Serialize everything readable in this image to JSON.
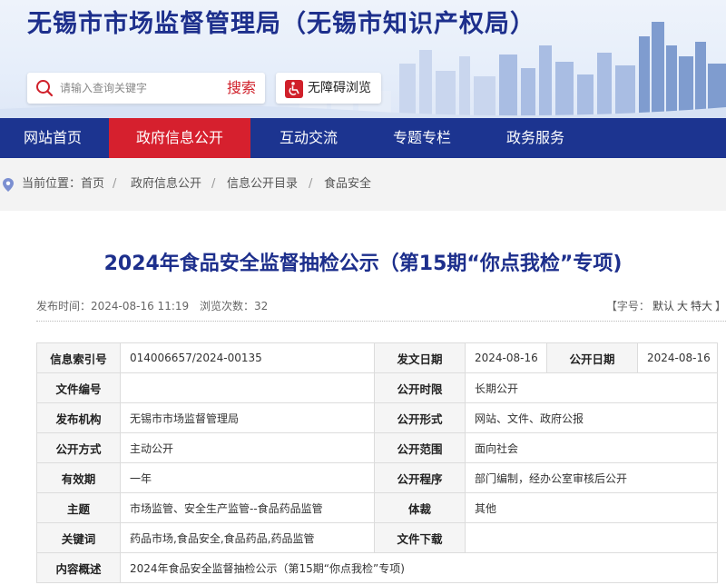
{
  "header": {
    "title": "无锡市市场监督管理局（无锡市知识产权局）",
    "search_placeholder": "请输入查询关键字",
    "search_button": "搜索",
    "accessibility_label": "无障碍浏览"
  },
  "nav": {
    "items": [
      "网站首页",
      "政府信息公开",
      "互动交流",
      "专题专栏",
      "政务服务"
    ],
    "active_index": 1
  },
  "breadcrumb": {
    "prefix": "当前位置：",
    "items": [
      "首页",
      "政府信息公开",
      "信息公开目录",
      "食品安全"
    ],
    "separator": "/"
  },
  "article": {
    "title": "2024年食品安全监督抽检公示（第15期“你点我检”专项)",
    "publish_time": "发布时间：2024-08-16 11:19",
    "views": "浏览次数：32",
    "font_size_prefix": "【字号：",
    "font_size_default": "默认",
    "font_size_large": "大",
    "font_size_xlarge": "特大",
    "font_size_suffix": "】"
  },
  "info_table": {
    "index_no_label": "信息索引号",
    "index_no": "014006657/2024-00135",
    "issue_date_label": "发文日期",
    "issue_date": "2024-08-16",
    "public_date_label": "公开日期",
    "public_date": "2024-08-16",
    "doc_no_label": "文件编号",
    "doc_no": "",
    "public_period_label": "公开时限",
    "public_period": "长期公开",
    "publisher_label": "发布机构",
    "publisher": "无锡市市场监督管理局",
    "public_form_label": "公开形式",
    "public_form": "网站、文件、政府公报",
    "public_method_label": "公开方式",
    "public_method": "主动公开",
    "public_scope_label": "公开范围",
    "public_scope": "面向社会",
    "validity_label": "有效期",
    "validity": "一年",
    "public_procedure_label": "公开程序",
    "public_procedure": "部门编制，经办公室审核后公开",
    "subject_label": "主题",
    "subject": "市场监管、安全生产监管--食品药品监管",
    "genre_label": "体裁",
    "genre": "其他",
    "keywords_label": "关键词",
    "keywords": "药品市场,食品安全,食品药品,药品监管",
    "download_label": "文件下载",
    "download": "",
    "summary_label": "内容概述",
    "summary": "2024年食品安全监督抽检公示（第15期“你点我检”专项)"
  },
  "colors": {
    "brand_blue": "#1c3490",
    "active_red": "#d6202e",
    "title_blue": "#1d2f8c"
  }
}
